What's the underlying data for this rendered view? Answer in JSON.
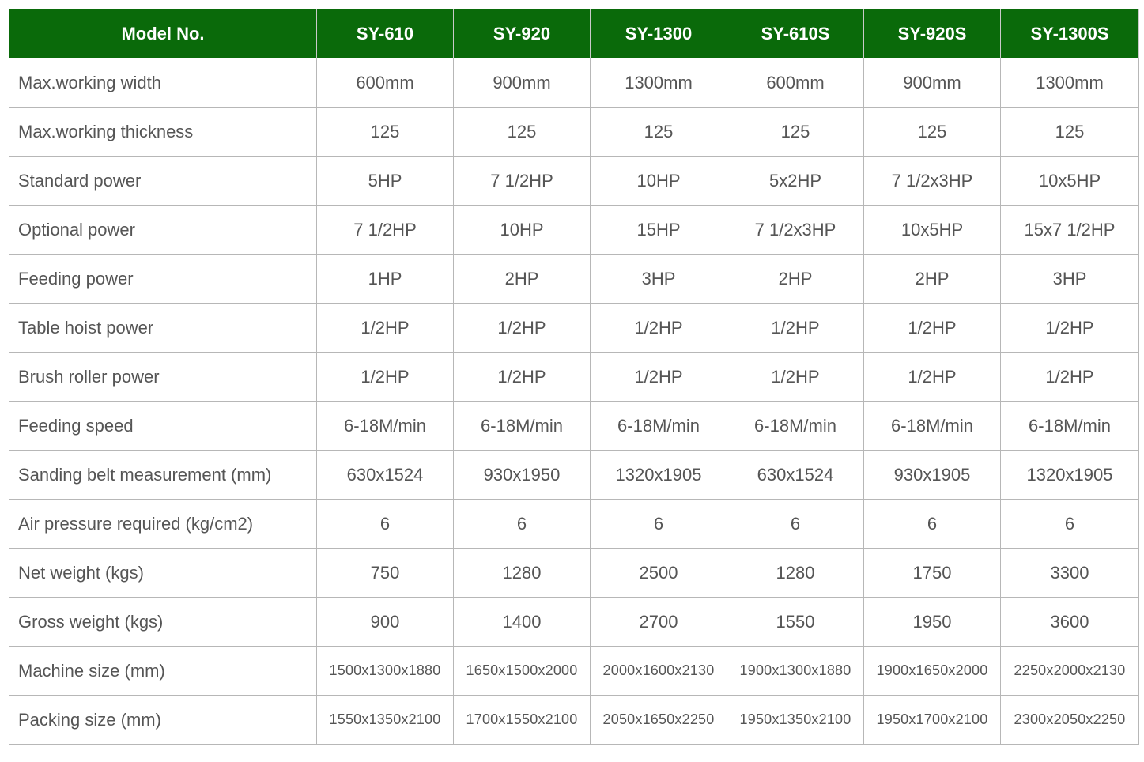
{
  "table": {
    "header_label": "Model No.",
    "models": [
      "SY-610",
      "SY-920",
      "SY-1300",
      "SY-610S",
      "SY-920S",
      "SY-1300S"
    ],
    "rows": [
      {
        "label": "Max.working width",
        "values": [
          "600mm",
          "900mm",
          "1300mm",
          "600mm",
          "900mm",
          "1300mm"
        ]
      },
      {
        "label": "Max.working thickness",
        "values": [
          "125",
          "125",
          "125",
          "125",
          "125",
          "125"
        ]
      },
      {
        "label": "Standard power",
        "values": [
          "5HP",
          "7 1/2HP",
          "10HP",
          "5x2HP",
          "7 1/2x3HP",
          "10x5HP"
        ]
      },
      {
        "label": "Optional power",
        "values": [
          "7 1/2HP",
          "10HP",
          "15HP",
          "7 1/2x3HP",
          "10x5HP",
          "15x7 1/2HP"
        ]
      },
      {
        "label": "Feeding power",
        "values": [
          "1HP",
          "2HP",
          "3HP",
          "2HP",
          "2HP",
          "3HP"
        ]
      },
      {
        "label": "Table hoist power",
        "values": [
          "1/2HP",
          "1/2HP",
          "1/2HP",
          "1/2HP",
          "1/2HP",
          "1/2HP"
        ]
      },
      {
        "label": "Brush roller power",
        "values": [
          "1/2HP",
          "1/2HP",
          "1/2HP",
          "1/2HP",
          "1/2HP",
          "1/2HP"
        ]
      },
      {
        "label": "Feeding speed",
        "values": [
          "6-18M/min",
          "6-18M/min",
          "6-18M/min",
          "6-18M/min",
          "6-18M/min",
          "6-18M/min"
        ]
      },
      {
        "label": "Sanding belt measurement (mm)",
        "values": [
          "630x1524",
          "930x1950",
          "1320x1905",
          "630x1524",
          "930x1905",
          "1320x1905"
        ]
      },
      {
        "label": "Air pressure required (kg/cm2)",
        "values": [
          "6",
          "6",
          "6",
          "6",
          "6",
          "6"
        ]
      },
      {
        "label": "Net weight (kgs)",
        "values": [
          "750",
          "1280",
          "2500",
          "1280",
          "1750",
          "3300"
        ]
      },
      {
        "label": "Gross weight (kgs)",
        "values": [
          "900",
          "1400",
          "2700",
          "1550",
          "1950",
          "3600"
        ]
      },
      {
        "label": "Machine size (mm)",
        "values": [
          "1500x1300x1880",
          "1650x1500x2000",
          "2000x1600x2130",
          "1900x1300x1880",
          "1900x1650x2000",
          "2250x2000x2130"
        ]
      },
      {
        "label": "Packing size (mm)",
        "values": [
          "1550x1350x2100",
          "1700x1550x2100",
          "2050x1650x2250",
          "1950x1350x2100",
          "1950x1700x2100",
          "2300x2050x2250"
        ]
      }
    ]
  }
}
